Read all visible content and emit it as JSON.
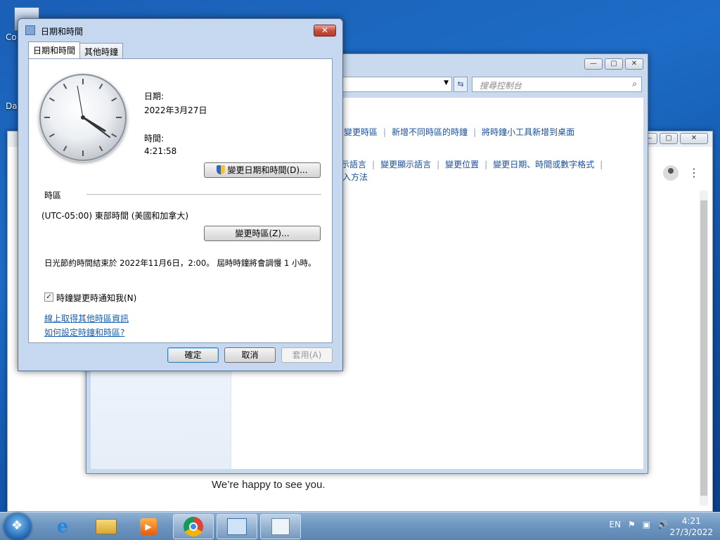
{
  "desktop": {
    "icons": [
      {
        "label": "Co"
      },
      {
        "label": "Data"
      }
    ]
  },
  "browser": {
    "welcome": "We’re happy to see you."
  },
  "control_panel": {
    "search_placeholder": "搜尋控制台",
    "links_row1": [
      "變更時區",
      "新增不同時區的時鐘",
      "將時鐘小工具新增到桌面"
    ],
    "links_row2": [
      "新增顯示語言",
      "變更顯示語言",
      "變更位置",
      "變更日期、時間或數字格式"
    ],
    "links_row2_prefix_cut": "示語言",
    "input_method": "入方法"
  },
  "dialog": {
    "title": "日期和時間",
    "tabs": [
      "日期和時間",
      "其他時鐘"
    ],
    "date_label": "日期:",
    "date_value": "2022年3月27日",
    "time_label": "時間:",
    "time_value": "4:21:58",
    "change_datetime_button": "變更日期和時間(D)...",
    "timezone_header": "時區",
    "timezone_value": "(UTC-05:00) 東部時間 (美國和加拿大)",
    "change_timezone_button": "變更時區(Z)...",
    "dst_note": "日光節約時間結束於 2022年11月6日，2:00。 屆時時鐘將會調慢 1 小時。",
    "notify_checkbox_label": "時鐘變更時通知我(N)",
    "notify_checked": true,
    "link_online": "線上取得其他時區資訊",
    "link_howto": "如何設定時鐘和時區?",
    "ok": "確定",
    "cancel": "取消",
    "apply": "套用(A)"
  },
  "taskbar": {
    "language": "EN",
    "time": "4:21",
    "date": "27/3/2022"
  }
}
